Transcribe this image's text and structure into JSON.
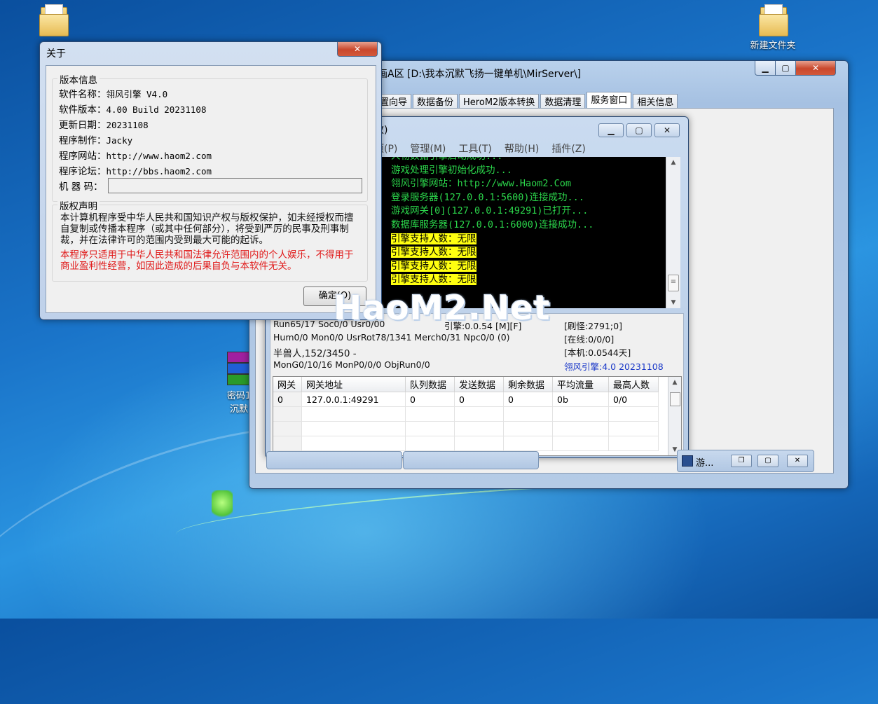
{
  "desktop": {
    "icons": [
      {
        "label": "新建文件夹"
      },
      {
        "label": "密码1"
      },
      {
        "label": "沉默"
      }
    ]
  },
  "main_window": {
    "title": "画A区 [D:\\我本沉默飞扬一键单机\\MirServer\\]",
    "tabs": [
      "置向导",
      "数据备份",
      "HeroM2版本转换",
      "数据清理",
      "服务窗口",
      "相关信息"
    ],
    "active_tab": "服务窗口"
  },
  "server_window": {
    "title": "收)",
    "menu": [
      "项(P)",
      "管理(M)",
      "工具(T)",
      "帮助(H)",
      "插件(Z)"
    ],
    "log": [
      {
        "prefix": "5",
        "text": "人物数据引擎启动成功...",
        "style": "green"
      },
      {
        "prefix": "5",
        "text": "游戏处理引擎初始化成功...",
        "style": "green"
      },
      {
        "prefix": "5",
        "text": "翎风引擎网站：http://www.Haom2.Com",
        "style": "green"
      },
      {
        "prefix": "5",
        "text": "登录服务器(127.0.0.1:5600)连接成功...",
        "style": "green"
      },
      {
        "prefix": "3",
        "text": "游戏网关[0](127.0.0.1:49291)已打开...",
        "style": "green"
      },
      {
        "prefix": "4",
        "text": "数据库服务器(127.0.0.1:6000)连接成功...",
        "style": "green"
      },
      {
        "prefix": "3",
        "text": "引擎支持人数：无限",
        "style": "yellow"
      },
      {
        "prefix": "3",
        "text": "引擎支持人数：无限",
        "style": "yellow"
      },
      {
        "prefix": "3",
        "text": "引擎支持人数：无限",
        "style": "yellow"
      },
      {
        "prefix": "3",
        "text": "引擎支持人数：无限",
        "style": "yellow"
      }
    ],
    "stats": {
      "run": "Run65/17 Soc0/0 Usr0/00",
      "engine": "引擎:0.0.54 [M][F]",
      "refresh": "[刷怪:2791;0]",
      "hum": "Hum0/0 Mon0/0 UsrRot78/1341 Merch0/31 Npc0/0 (0)",
      "online": "[在线:0/0/0]",
      "monster": "半兽人,152/3450 -",
      "machine": "[本机:0.0544天]",
      "mong": "MonG0/10/16 MonP0/0/0 ObjRun0/0",
      "version": "翎风引擎:4.0 20231108"
    },
    "gateway_table": {
      "headers": [
        "网关",
        "网关地址",
        "队列数据",
        "发送数据",
        "剩余数据",
        "平均流量",
        "最高人数"
      ],
      "rows": [
        [
          "0",
          "127.0.0.1:49291",
          "0",
          "0",
          "0",
          "0b",
          "0/0"
        ]
      ]
    },
    "minimized_label": "游..."
  },
  "about_dialog": {
    "title": "关于",
    "version_group": "版本信息",
    "fields": [
      {
        "label": "软件名称：",
        "value": "翎风引擎 V4.0"
      },
      {
        "label": "软件版本：",
        "value": "4.00 Build 20231108"
      },
      {
        "label": "更新日期：",
        "value": "20231108"
      },
      {
        "label": "程序制作：",
        "value": "Jacky"
      },
      {
        "label": "程序网站：",
        "value": "http://www.haom2.com"
      },
      {
        "label": "程序论坛：",
        "value": "http://bbs.haom2.com"
      }
    ],
    "machine_code_label": "机 器 码：",
    "machine_code_value": "",
    "copyright_group": "版权声明",
    "copyright_text": "本计算机程序受中华人民共和国知识产权与版权保护，如未经授权而擅自复制或传播本程序（或其中任何部分），将受到严厉的民事及刑事制裁，并在法律许可的范围内受到最大可能的起诉。",
    "warning_text": "本程序只适用于中华人民共和国法律允许范围内的个人娱乐，不得用于商业盈利性经营，如因此造成的后果自负与本软件无关。",
    "ok_button": "确定(O)"
  },
  "watermark": "HaoM2.Net",
  "colors": {
    "console_text": "#2bd64b",
    "console_highlight": "#ffff10",
    "warning": "#e01818",
    "version_blue": "#1a38c8"
  }
}
